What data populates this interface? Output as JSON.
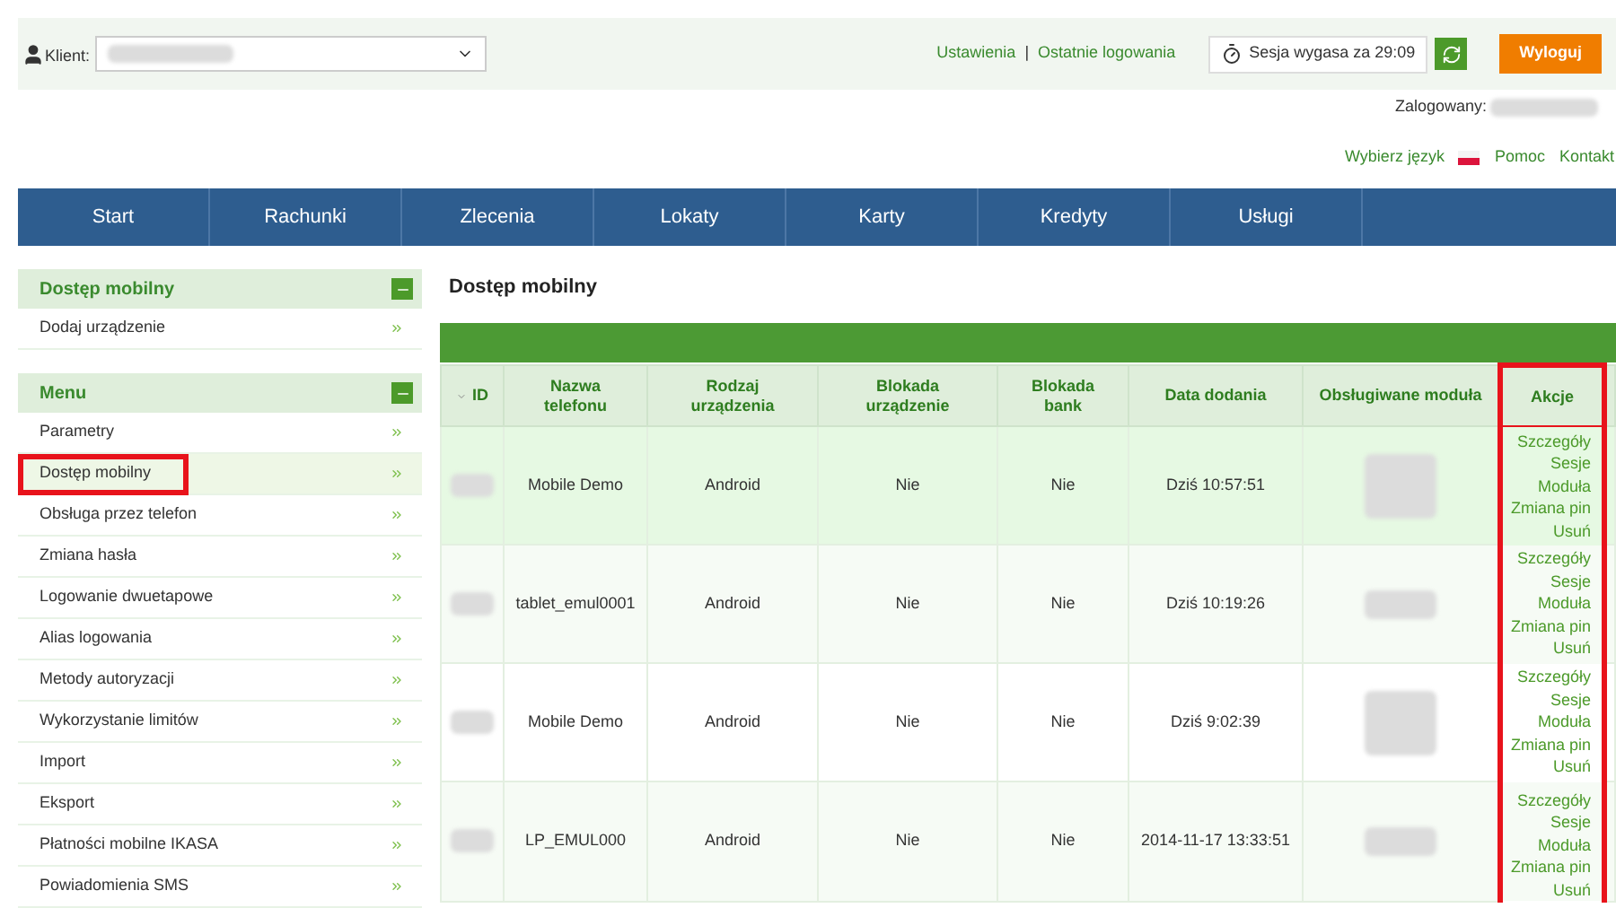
{
  "topbar": {
    "client_label": "Klient:",
    "links": [
      "Ustawienia",
      "Ostatnie logowania"
    ],
    "link_separator": "|",
    "session": "Sesja wygasa za 29:09",
    "logout": "Wyloguj",
    "logged_in_label": "Zalogowany:",
    "language_label": "Wybierz język",
    "help": "Pomoc",
    "contact": "Kontakt"
  },
  "nav": [
    "Start",
    "Rachunki",
    "Zlecenia",
    "Lokaty",
    "Karty",
    "Kredyty",
    "Usługi"
  ],
  "sidebar": [
    {
      "title": "Dostęp mobilny",
      "expanded": true,
      "items": [
        {
          "label": "Dodaj urządzenie",
          "selected": false,
          "highlighted": false
        }
      ]
    },
    {
      "title": "Menu",
      "expanded": true,
      "items": [
        {
          "label": "Parametry",
          "selected": false,
          "highlighted": false
        },
        {
          "label": "Dostęp mobilny",
          "selected": true,
          "highlighted": true
        },
        {
          "label": "Obsługa przez telefon",
          "selected": false,
          "highlighted": false
        },
        {
          "label": "Zmiana hasła",
          "selected": false,
          "highlighted": false
        },
        {
          "label": "Logowanie dwuetapowe",
          "selected": false,
          "highlighted": false
        },
        {
          "label": "Alias logowania",
          "selected": false,
          "highlighted": false
        },
        {
          "label": "Metody autoryzacji",
          "selected": false,
          "highlighted": false
        },
        {
          "label": "Wykorzystanie limitów",
          "selected": false,
          "highlighted": false
        },
        {
          "label": "Import",
          "selected": false,
          "highlighted": false
        },
        {
          "label": "Eksport",
          "selected": false,
          "highlighted": false
        },
        {
          "label": "Płatności mobilne IKASA",
          "selected": false,
          "highlighted": false
        },
        {
          "label": "Powiadomienia SMS",
          "selected": false,
          "highlighted": false
        }
      ]
    }
  ],
  "page_title": "Dostęp mobilny",
  "table": {
    "columns": [
      {
        "label": "ID",
        "highlighted": false
      },
      {
        "label": "Nazwa telefonu",
        "highlighted": false
      },
      {
        "label": "Rodzaj urządzenia",
        "highlighted": false
      },
      {
        "label": "Blokada urządzenie",
        "highlighted": false
      },
      {
        "label": "Blokada bank",
        "highlighted": false
      },
      {
        "label": "Data dodania",
        "highlighted": false
      },
      {
        "label": "Obsługiwane moduła",
        "highlighted": false
      },
      {
        "label": "Akcje",
        "highlighted": true
      }
    ],
    "rows": [
      {
        "selected": true,
        "name": "Mobile Demo",
        "type": "Android",
        "device_lock": "Nie",
        "bank_lock": "Nie",
        "added": "Dziś 10:57:51",
        "actions": [
          "Szczegóły",
          "Sesje",
          "Moduła",
          "Zmiana pin",
          "Usuń"
        ]
      },
      {
        "selected": false,
        "name": "tablet_emul0001",
        "type": "Android",
        "device_lock": "Nie",
        "bank_lock": "Nie",
        "added": "Dziś 10:19:26",
        "actions": [
          "Szczegóły",
          "Sesje",
          "Moduła",
          "Zmiana pin",
          "Usuń"
        ]
      },
      {
        "selected": false,
        "name": "Mobile Demo",
        "type": "Android",
        "device_lock": "Nie",
        "bank_lock": "Nie",
        "added": "Dziś 9:02:39",
        "actions": [
          "Szczegóły",
          "Sesje",
          "Moduła",
          "Zmiana pin",
          "Usuń"
        ]
      },
      {
        "selected": false,
        "name": "LP_EMUL000",
        "type": "Android",
        "device_lock": "Nie",
        "bank_lock": "Nie",
        "added": "2014-11-17 13:33:51",
        "actions": [
          "Szczegóły",
          "Sesje",
          "Moduła",
          "Zmiana pin",
          "Usuń"
        ]
      }
    ]
  }
}
